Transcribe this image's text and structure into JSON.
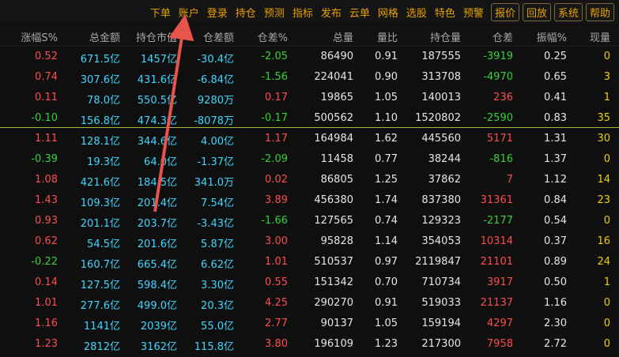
{
  "menu": [
    "下单",
    "账户",
    "登录",
    "持仓",
    "预测",
    "指标",
    "发布",
    "云单",
    "网格",
    "选股",
    "特色",
    "预警"
  ],
  "buttons": [
    "报价",
    "回放",
    "系统",
    "帮助"
  ],
  "headers": [
    "涨幅S%",
    "总金额",
    "持仓市值",
    "仓差额",
    "仓差%",
    "总量",
    "量比",
    "持仓量",
    "仓差",
    "振幅%",
    "现量"
  ],
  "rows": [
    [
      "0.52",
      "671.5亿",
      "1457亿",
      "-30.4亿",
      "-2.05",
      "86490",
      "0.91",
      "187555",
      "-3919",
      "0.25",
      "0"
    ],
    [
      "0.74",
      "307.6亿",
      "431.6亿",
      "-6.84亿",
      "-1.56",
      "224041",
      "0.90",
      "313708",
      "-4970",
      "0.65",
      "3"
    ],
    [
      "0.11",
      "78.0亿",
      "550.5亿",
      "9280万",
      "0.17",
      "19865",
      "1.05",
      "140013",
      "236",
      "0.41",
      "1"
    ],
    [
      "-0.10",
      "156.8亿",
      "474.3亿",
      "-8078万",
      "-0.17",
      "500562",
      "1.10",
      "1520802",
      "-2590",
      "0.83",
      "35"
    ],
    [
      "1.11",
      "128.1亿",
      "344.6亿",
      "4.00亿",
      "1.17",
      "164984",
      "1.62",
      "445560",
      "5171",
      "1.31",
      "30"
    ],
    [
      "-0.39",
      "19.3亿",
      "64.0亿",
      "-1.37亿",
      "-2.09",
      "11458",
      "0.77",
      "38244",
      "-816",
      "1.37",
      "0"
    ],
    [
      "1.08",
      "421.6亿",
      "184.5亿",
      "341.0万",
      "0.02",
      "86805",
      "1.25",
      "37862",
      "7",
      "1.12",
      "14"
    ],
    [
      "1.43",
      "109.3亿",
      "201.4亿",
      "7.54亿",
      "3.89",
      "456380",
      "1.74",
      "837380",
      "31361",
      "0.84",
      "23"
    ],
    [
      "0.93",
      "201.1亿",
      "203.7亿",
      "-3.43亿",
      "-1.66",
      "127565",
      "0.74",
      "129323",
      "-2177",
      "0.54",
      "0"
    ],
    [
      "0.62",
      "54.5亿",
      "201.6亿",
      "5.87亿",
      "3.00",
      "95828",
      "1.14",
      "354053",
      "10314",
      "0.37",
      "16"
    ],
    [
      "-0.22",
      "160.7亿",
      "665.4亿",
      "6.62亿",
      "1.01",
      "510537",
      "0.97",
      "2119847",
      "21101",
      "0.89",
      "24"
    ],
    [
      "0.14",
      "127.5亿",
      "598.4亿",
      "3.30亿",
      "0.55",
      "151342",
      "0.70",
      "710734",
      "3917",
      "0.50",
      "1"
    ],
    [
      "1.01",
      "277.6亿",
      "499.0亿",
      "20.3亿",
      "4.25",
      "290270",
      "0.91",
      "519033",
      "21137",
      "1.16",
      "0"
    ],
    [
      "1.16",
      "1141亿",
      "2039亿",
      "55.0亿",
      "2.77",
      "90137",
      "1.05",
      "159194",
      "4297",
      "2.30",
      "0"
    ],
    [
      "1.23",
      "2812亿",
      "3162亿",
      "115.8亿",
      "3.80",
      "196109",
      "1.23",
      "217300",
      "7958",
      "2.72",
      "0"
    ]
  ],
  "colors": {
    "menu": "#e8a200",
    "up": "#ff4d4d",
    "down": "#35d335",
    "cyan": "#3fd7ff",
    "arrow": "#e8534a",
    "separator": "#b8b83a"
  }
}
